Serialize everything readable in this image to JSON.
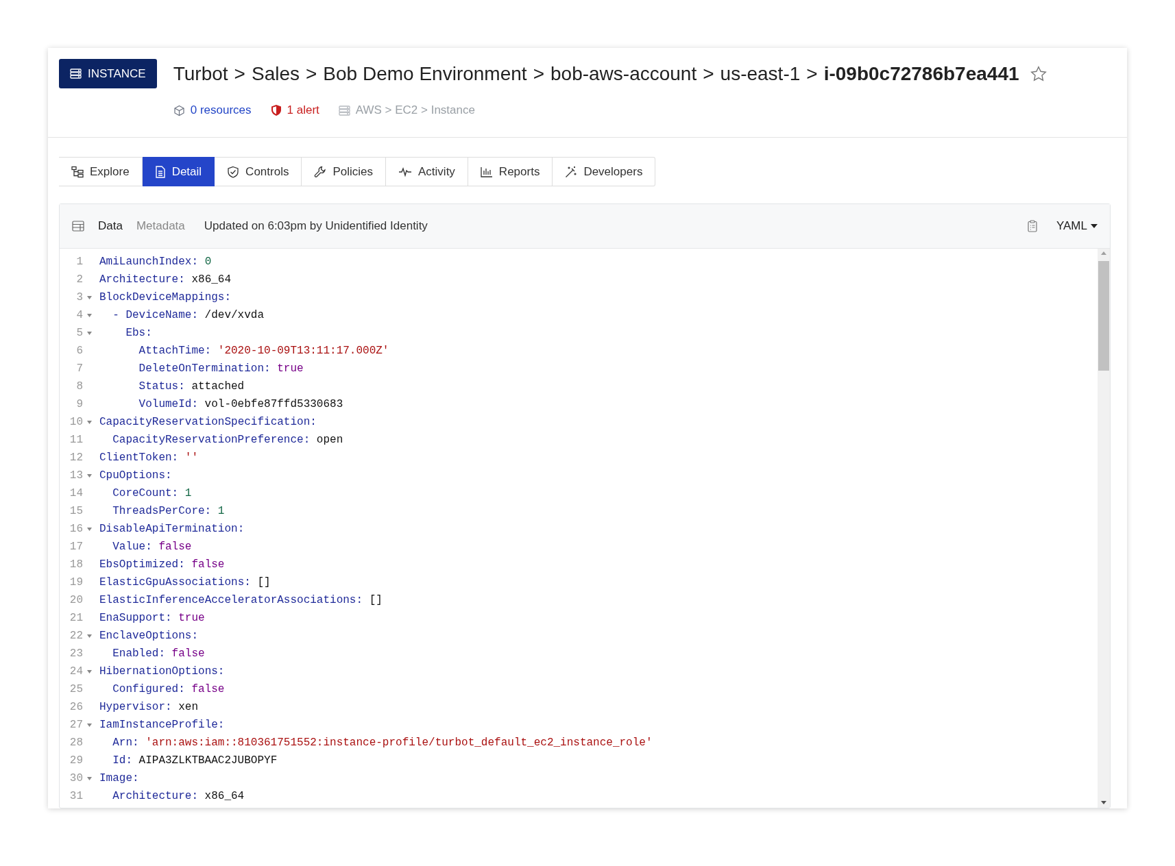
{
  "badge": {
    "label": "INSTANCE"
  },
  "breadcrumb": [
    {
      "text": "Turbot",
      "kind": "crumb"
    },
    {
      "text": ">",
      "kind": "separator"
    },
    {
      "text": "Sales",
      "kind": "crumb"
    },
    {
      "text": ">",
      "kind": "separator"
    },
    {
      "text": "Bob Demo Environment",
      "kind": "crumb"
    },
    {
      "text": ">",
      "kind": "separator"
    },
    {
      "text": "bob-aws-account",
      "kind": "crumb"
    },
    {
      "text": ">",
      "kind": "separator"
    },
    {
      "text": "us-east-1",
      "kind": "crumb"
    },
    {
      "text": ">",
      "kind": "separator"
    },
    {
      "text": "i-09b0c72786b7ea441",
      "kind": "current"
    }
  ],
  "favorite": {
    "on": false
  },
  "meta": {
    "resources": "0 resources",
    "alerts": "1 alert",
    "type_path": "AWS > EC2 > Instance"
  },
  "tabs": [
    {
      "label": "Explore",
      "selected": false
    },
    {
      "label": "Detail",
      "selected": true
    },
    {
      "label": "Controls",
      "selected": false
    },
    {
      "label": "Policies",
      "selected": false
    },
    {
      "label": "Activity",
      "selected": false
    },
    {
      "label": "Reports",
      "selected": false
    },
    {
      "label": "Developers",
      "selected": false
    }
  ],
  "panel": {
    "views": [
      {
        "label": "Data",
        "selected": true
      },
      {
        "label": "Metadata",
        "selected": false
      }
    ],
    "updated": "Updated on 6:03pm by Unidentified Identity",
    "format": "YAML",
    "lines": [
      {
        "n": "1",
        "key": "AmiLaunchIndex:",
        "value": "0",
        "kind": "number"
      },
      {
        "n": "2",
        "key": "Architecture:",
        "value": "x86_64",
        "kind": "plain"
      },
      {
        "n": "3",
        "key": "BlockDeviceMappings:",
        "expanded": true,
        "children": [
          {
            "n": "4",
            "marker": "-",
            "key": "DeviceName:",
            "value": "/dev/xvda",
            "kind": "plain",
            "expanded": true,
            "children": [
              {
                "n": "5",
                "key": "Ebs:",
                "expanded": true,
                "children": [
                  {
                    "n": "6",
                    "key": "AttachTime:",
                    "value": "'2020-10-09T13:11:17.000Z'",
                    "kind": "string"
                  },
                  {
                    "n": "7",
                    "key": "DeleteOnTermination:",
                    "value": "true",
                    "kind": "keyword"
                  },
                  {
                    "n": "8",
                    "key": "Status:",
                    "value": "attached",
                    "kind": "plain"
                  },
                  {
                    "n": "9",
                    "key": "VolumeId:",
                    "value": "vol-0ebfe87ffd5330683",
                    "kind": "plain"
                  }
                ]
              }
            ]
          }
        ]
      },
      {
        "n": "10",
        "key": "CapacityReservationSpecification:",
        "expanded": true,
        "children": [
          {
            "n": "11",
            "key": "CapacityReservationPreference:",
            "value": "open",
            "kind": "plain"
          }
        ]
      },
      {
        "n": "12",
        "key": "ClientToken:",
        "value": "''",
        "kind": "string"
      },
      {
        "n": "13",
        "key": "CpuOptions:",
        "expanded": true,
        "children": [
          {
            "n": "14",
            "key": "CoreCount:",
            "value": "1",
            "kind": "number"
          },
          {
            "n": "15",
            "key": "ThreadsPerCore:",
            "value": "1",
            "kind": "number"
          }
        ]
      },
      {
        "n": "16",
        "key": "DisableApiTermination:",
        "expanded": true,
        "children": [
          {
            "n": "17",
            "key": "Value:",
            "value": "false",
            "kind": "keyword"
          }
        ]
      },
      {
        "n": "18",
        "key": "EbsOptimized:",
        "value": "false",
        "kind": "keyword"
      },
      {
        "n": "19",
        "key": "ElasticGpuAssociations:",
        "value": "[]",
        "kind": "plain"
      },
      {
        "n": "20",
        "key": "ElasticInferenceAcceleratorAssociations:",
        "value": "[]",
        "kind": "plain"
      },
      {
        "n": "21",
        "key": "EnaSupport:",
        "value": "true",
        "kind": "keyword"
      },
      {
        "n": "22",
        "key": "EnclaveOptions:",
        "expanded": true,
        "children": [
          {
            "n": "23",
            "key": "Enabled:",
            "value": "false",
            "kind": "keyword"
          }
        ]
      },
      {
        "n": "24",
        "key": "HibernationOptions:",
        "expanded": true,
        "children": [
          {
            "n": "25",
            "key": "Configured:",
            "value": "false",
            "kind": "keyword"
          }
        ]
      },
      {
        "n": "26",
        "key": "Hypervisor:",
        "value": "xen",
        "kind": "plain"
      },
      {
        "n": "27",
        "key": "IamInstanceProfile:",
        "expanded": true,
        "children": [
          {
            "n": "28",
            "key": "Arn:",
            "value": "'arn:aws:iam::810361751552:instance-profile/turbot_default_ec2_instance_role'",
            "kind": "string"
          },
          {
            "n": "29",
            "key": "Id:",
            "value": "AIPA3ZLKTBAAC2JUBOPYF",
            "kind": "plain"
          }
        ]
      },
      {
        "n": "30",
        "key": "Image:",
        "expanded": true,
        "children": [
          {
            "n": "31",
            "key": "Architecture:",
            "value": "x86_64",
            "kind": "plain"
          }
        ]
      }
    ]
  }
}
